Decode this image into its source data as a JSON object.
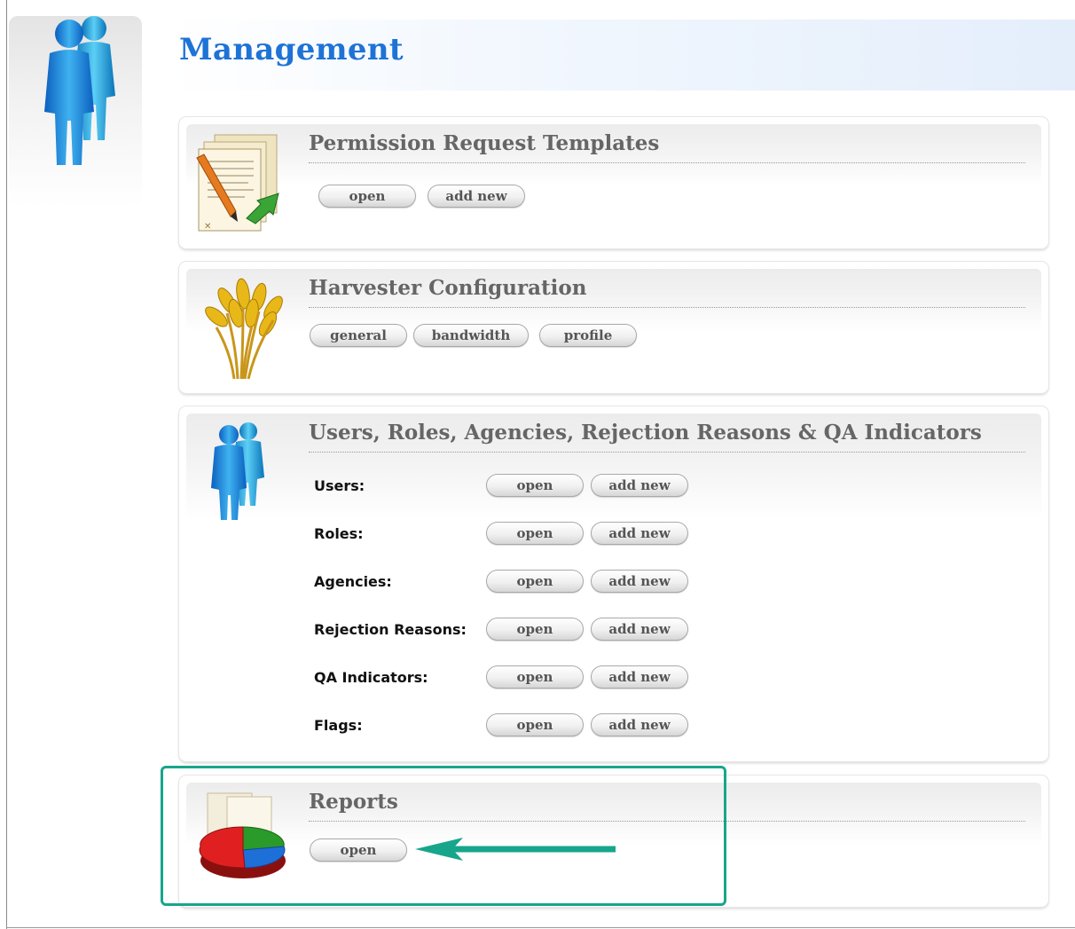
{
  "page": {
    "title": "Management"
  },
  "colors": {
    "title": "#1e73d6",
    "accent_arrow": "#17a68b"
  },
  "icons": {
    "header": "users-group-icon",
    "templates": "document-edit-icon",
    "harvester": "wheat-icon",
    "users": "users-group-icon",
    "reports": "pie-chart-report-icon"
  },
  "sections": {
    "templates": {
      "title": "Permission Request Templates",
      "buttons": {
        "open": "open",
        "add_new": "add new"
      }
    },
    "harvester": {
      "title": "Harvester Configuration",
      "buttons": {
        "general": "general",
        "bandwidth": "bandwidth",
        "profile": "profile"
      }
    },
    "users": {
      "title": "Users, Roles, Agencies, Rejection Reasons & QA Indicators",
      "rows": [
        {
          "label": "Users:",
          "open": "open",
          "add_new": "add new"
        },
        {
          "label": "Roles:",
          "open": "open",
          "add_new": "add new"
        },
        {
          "label": "Agencies:",
          "open": "open",
          "add_new": "add new"
        },
        {
          "label": "Rejection Reasons:",
          "open": "open",
          "add_new": "add new"
        },
        {
          "label": "QA Indicators:",
          "open": "open",
          "add_new": "add new"
        },
        {
          "label": "Flags:",
          "open": "open",
          "add_new": "add new"
        }
      ]
    },
    "reports": {
      "title": "Reports",
      "buttons": {
        "open": "open"
      }
    }
  }
}
